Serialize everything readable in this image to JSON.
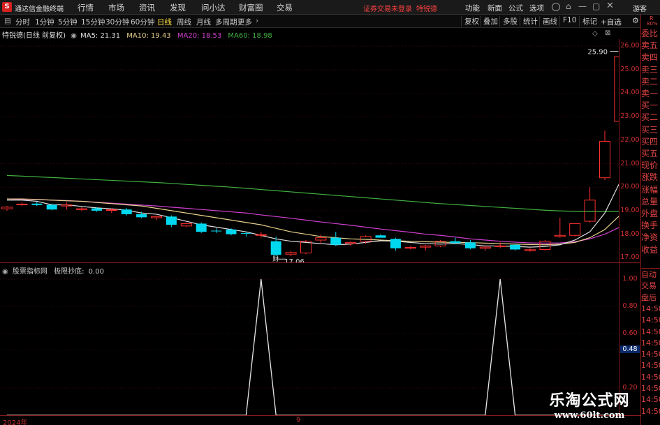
{
  "app": {
    "title": "通达信金融终端"
  },
  "menu": {
    "items": [
      "行情",
      "市场",
      "资讯",
      "发现",
      "问小达",
      "财富圈",
      "交易"
    ],
    "notice": "证券交易未登录",
    "stock_hint": "特锐德",
    "right_items": [
      "功能",
      "新面",
      "公式",
      "选项"
    ],
    "guest": "游客"
  },
  "periods": {
    "items": [
      "分时",
      "1分钟",
      "5分钟",
      "15分钟",
      "30分钟",
      "60分钟",
      "日线",
      "周线",
      "月线",
      "多周期",
      "更多"
    ],
    "active": "日线"
  },
  "toolbar_right": {
    "items": [
      "复权",
      "叠加",
      "多股",
      "统计",
      "画线",
      "F10",
      "标记"
    ],
    "zixuan": "+自选"
  },
  "info": {
    "stock": "特锐德(日线 前复权)",
    "ma5": "MA5: 21.31",
    "ma10": "MA10: 19.43",
    "ma20": "MA20: 18.53",
    "ma60": "MA60: 18.98"
  },
  "annotations": {
    "high": "25.90",
    "low": "17.06",
    "cai": "财"
  },
  "yaxis_main": [
    "26.00",
    "25.00",
    "24.00",
    "23.00",
    "22.00",
    "21.00",
    "20.00",
    "19.00",
    "18.00",
    "17.00"
  ],
  "yaxis_sub": [
    "1.00",
    "0.80",
    "0.60",
    "0.48",
    "0.20"
  ],
  "indicator": {
    "name": "股票指标网",
    "label": "极限抄底:",
    "value": "0.00"
  },
  "xaxis": {
    "start": "2024年",
    "mid": "9"
  },
  "side_top": {
    "rlabel": "R",
    "pct": "80%",
    "items": [
      "委比",
      "卖五",
      "卖四",
      "卖三",
      "卖二",
      "卖一",
      "买一",
      "买二",
      "买三",
      "买四",
      "买五",
      "现价",
      "涨跌",
      "涨幅",
      "总量",
      "外盘",
      "换手",
      "净资",
      "收益"
    ]
  },
  "side_bottom": {
    "items": [
      "自动",
      "交易",
      "盘后",
      "14:50",
      "14:50",
      "14:50",
      "14:50",
      "14:50",
      "14:50",
      "14:50",
      "14:50",
      "14:50",
      "14:50"
    ]
  },
  "watermark": {
    "title": "乐淘公式网",
    "url": "www.60lt.com"
  },
  "colors": {
    "up": "#ff3030",
    "down": "#00d8f0",
    "ma5": "#e0e0e0",
    "ma10": "#e8d08c",
    "ma20": "#d040d0",
    "ma60": "#40b040",
    "accent": "#c00000"
  },
  "chart_data": [
    {
      "type": "candlestick",
      "ylim": [
        16.8,
        26.3
      ],
      "candles": [
        [
          19.08,
          19.2,
          19.0,
          19.15
        ],
        [
          19.25,
          19.35,
          19.2,
          19.28
        ],
        [
          19.3,
          19.38,
          19.2,
          19.24
        ],
        [
          19.25,
          19.3,
          19.02,
          19.05
        ],
        [
          19.2,
          19.35,
          19.05,
          19.25
        ],
        [
          19.05,
          19.15,
          18.98,
          19.08
        ],
        [
          19.1,
          19.15,
          18.95,
          19.0
        ],
        [
          19.02,
          19.1,
          18.9,
          19.04
        ],
        [
          19.05,
          19.12,
          18.8,
          18.85
        ],
        [
          18.85,
          18.95,
          18.68,
          18.72
        ],
        [
          18.7,
          18.8,
          18.6,
          18.75
        ],
        [
          18.75,
          18.8,
          18.3,
          18.4
        ],
        [
          18.35,
          18.5,
          18.3,
          18.45
        ],
        [
          18.45,
          18.5,
          18.05,
          18.1
        ],
        [
          18.15,
          18.25,
          18.05,
          18.12
        ],
        [
          18.2,
          18.25,
          17.95,
          18.0
        ],
        [
          18.05,
          18.1,
          17.9,
          18.02
        ],
        [
          17.95,
          18.1,
          17.85,
          17.98
        ],
        [
          17.7,
          17.9,
          17.06,
          17.12
        ],
        [
          17.15,
          17.3,
          17.06,
          17.22
        ],
        [
          17.2,
          17.75,
          17.15,
          17.7
        ],
        [
          17.75,
          17.98,
          17.6,
          17.85
        ],
        [
          17.85,
          18.1,
          17.5,
          17.55
        ],
        [
          17.6,
          17.7,
          17.5,
          17.65
        ],
        [
          17.7,
          17.95,
          17.6,
          17.9
        ],
        [
          17.95,
          18.0,
          17.9,
          17.85
        ],
        [
          17.8,
          17.85,
          17.3,
          17.4
        ],
        [
          17.4,
          17.5,
          17.35,
          17.44
        ],
        [
          17.45,
          17.55,
          17.3,
          17.5
        ],
        [
          17.5,
          17.75,
          17.45,
          17.7
        ],
        [
          17.7,
          17.85,
          17.6,
          17.62
        ],
        [
          17.65,
          17.75,
          17.35,
          17.4
        ],
        [
          17.4,
          17.5,
          17.3,
          17.45
        ],
        [
          17.5,
          17.65,
          17.4,
          17.5
        ],
        [
          17.55,
          17.6,
          17.3,
          17.35
        ],
        [
          17.3,
          17.4,
          17.25,
          17.34
        ],
        [
          17.35,
          17.75,
          17.3,
          17.7
        ],
        [
          17.9,
          18.7,
          17.85,
          17.95
        ],
        [
          17.95,
          18.45,
          17.9,
          18.45
        ],
        [
          18.55,
          20.0,
          18.5,
          19.45
        ],
        [
          20.4,
          22.4,
          20.3,
          21.95
        ],
        [
          22.8,
          25.9,
          22.5,
          25.55
        ],
        [
          23.45,
          23.6,
          21.95,
          22.0
        ]
      ],
      "ma5": [
        19.45,
        19.45,
        19.4,
        19.25,
        19.25,
        19.18,
        19.12,
        19.08,
        19.02,
        18.9,
        18.85,
        18.7,
        18.55,
        18.4,
        18.3,
        18.2,
        18.1,
        17.95,
        17.8,
        17.7,
        17.65,
        17.6,
        17.55,
        17.58,
        17.65,
        17.72,
        17.7,
        17.65,
        17.6,
        17.58,
        17.6,
        17.56,
        17.5,
        17.5,
        17.48,
        17.45,
        17.48,
        17.55,
        17.75,
        18.1,
        18.9,
        20.2,
        21.31
      ],
      "ma10": [
        19.5,
        19.5,
        19.48,
        19.45,
        19.42,
        19.4,
        19.35,
        19.3,
        19.25,
        19.2,
        19.1,
        19.0,
        18.9,
        18.8,
        18.7,
        18.6,
        18.5,
        18.4,
        18.25,
        18.1,
        18.0,
        17.9,
        17.85,
        17.8,
        17.78,
        17.75,
        17.72,
        17.7,
        17.68,
        17.66,
        17.65,
        17.64,
        17.62,
        17.6,
        17.58,
        17.56,
        17.55,
        17.58,
        17.65,
        17.85,
        18.2,
        18.8,
        19.43
      ],
      "ma20": [
        19.5,
        19.48,
        19.47,
        19.45,
        19.43,
        19.4,
        19.36,
        19.32,
        19.28,
        19.24,
        19.2,
        19.15,
        19.1,
        19.05,
        19.0,
        18.95,
        18.9,
        18.82,
        18.75,
        18.68,
        18.6,
        18.52,
        18.45,
        18.38,
        18.3,
        18.22,
        18.15,
        18.08,
        18.0,
        17.95,
        17.88,
        17.8,
        17.75,
        17.7,
        17.66,
        17.63,
        17.62,
        17.63,
        17.68,
        17.8,
        18.0,
        18.3,
        18.53
      ],
      "ma60": [
        20.5,
        20.47,
        20.44,
        20.41,
        20.38,
        20.35,
        20.32,
        20.29,
        20.26,
        20.23,
        20.2,
        20.16,
        20.12,
        20.08,
        20.04,
        20.0,
        19.95,
        19.9,
        19.85,
        19.8,
        19.75,
        19.7,
        19.65,
        19.6,
        19.55,
        19.5,
        19.45,
        19.4,
        19.35,
        19.3,
        19.26,
        19.22,
        19.18,
        19.14,
        19.1,
        19.06,
        19.02,
        18.99,
        18.97,
        18.96,
        18.96,
        18.97,
        18.98
      ]
    },
    {
      "type": "line",
      "title": "极限抄底",
      "ylim": [
        0,
        1
      ],
      "x": [
        0,
        16,
        17,
        18,
        32,
        33,
        34,
        42
      ],
      "values": [
        0,
        0,
        1,
        0,
        0,
        1,
        0,
        0
      ]
    }
  ]
}
